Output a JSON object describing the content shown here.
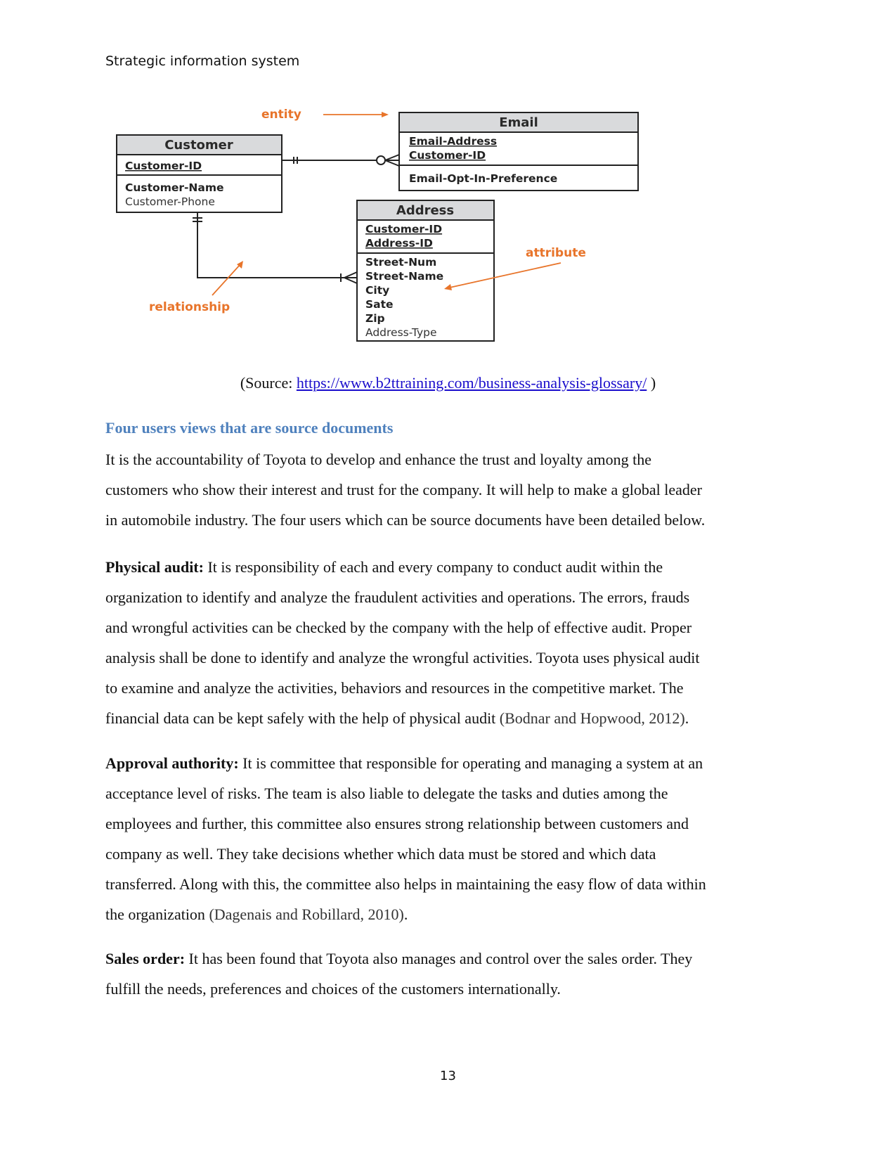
{
  "header": {
    "running_title": "Strategic information system"
  },
  "diagram": {
    "annotations": {
      "entity": "entity",
      "attribute": "attribute",
      "relationship": "relationship"
    },
    "entities": {
      "customer": {
        "name": "Customer",
        "keys": [
          "Customer-ID"
        ],
        "attributes": [
          "Customer-Name",
          "Customer-Phone"
        ]
      },
      "email": {
        "name": "Email",
        "keys": [
          "Email-Address",
          "Customer-ID"
        ],
        "attributes": [
          "Email-Opt-In-Preference"
        ]
      },
      "address": {
        "name": "Address",
        "keys": [
          "Customer-ID",
          "Address-ID"
        ],
        "attributes": [
          "Street-Num",
          "Street-Name",
          "City",
          "Sate",
          "Zip",
          "Address-Type"
        ]
      }
    },
    "relationships": [
      {
        "from": "Customer",
        "to": "Email",
        "from_cardinality": "one-and-only-one",
        "to_cardinality": "zero-or-many"
      },
      {
        "from": "Customer",
        "to": "Address",
        "from_cardinality": "one-and-only-one",
        "to_cardinality": "one-or-many"
      }
    ],
    "colors": {
      "annotation": "#e8742a",
      "header_fill": "#d9dadc"
    }
  },
  "source": {
    "prefix": "(Source: ",
    "link_text": "https://www.b2ttraining.com/business-analysis-glossary/",
    "suffix": " )"
  },
  "section": {
    "heading": "Four users views that are source documents",
    "intro_lines": [
      "It is the accountability of Toyota to develop and enhance the trust and loyalty among the",
      "customers who show their interest and trust for the company. It will help to make a global leader",
      "in automobile industry. The four users which can be source documents have been detailed below."
    ],
    "paragraphs": [
      {
        "term": "Physical audit:",
        "lines": [
          " It is responsibility of each and every company to conduct audit within the",
          "organization to identify and analyze the fraudulent activities and operations. The errors, frauds",
          "and wrongful activities can be checked by the company with the help of effective audit. Proper",
          "analysis shall be done to identify and analyze the wrongful activities. Toyota uses physical audit",
          "to examine and analyze the activities, behaviors and resources in the competitive market. The",
          "financial data can be kept safely with the help of physical audit "
        ],
        "citation": "(Bodnar and Hopwood, 2012)",
        "end": "."
      },
      {
        "term": "Approval authority:",
        "lines": [
          " It is committee that responsible for operating and managing a system at an",
          "acceptance level of risks. The team is also liable to delegate the tasks and duties among the",
          "employees and further, this committee also ensures strong relationship between customers and",
          "company as well. They take decisions whether which data must be stored and which data",
          "transferred. Along with this, the committee also helps in maintaining the easy flow of data within",
          "the organization "
        ],
        "citation": "(Dagenais and Robillard, 2010)",
        "end": "."
      },
      {
        "term": "Sales order:",
        "lines": [
          " It has been found that Toyota also manages and control over the sales order. They",
          "fulfill the needs, preferences and choices of the customers internationally."
        ]
      }
    ]
  },
  "footer": {
    "page_number": "13"
  }
}
